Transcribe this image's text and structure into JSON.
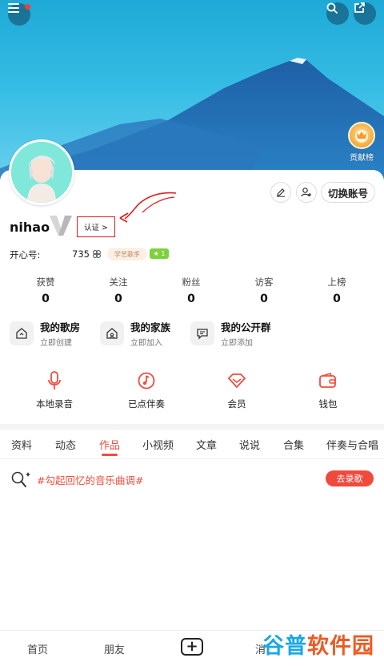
{
  "header": {
    "menu_icon": "menu-icon",
    "search_icon": "search-icon",
    "share_icon": "share-icon",
    "rank_label": "贡献榜"
  },
  "profile": {
    "username": "nihao",
    "verify_label": "认证 >",
    "kaixin_label": "开心号:",
    "kaixin_id": "735",
    "art_badge": "学艺歌手",
    "level": "1",
    "switch_account": "切换账号"
  },
  "stats": [
    {
      "label": "获赞",
      "value": "0"
    },
    {
      "label": "关注",
      "value": "0"
    },
    {
      "label": "粉丝",
      "value": "0"
    },
    {
      "label": "访客",
      "value": "0"
    },
    {
      "label": "上榜",
      "value": "0"
    }
  ],
  "features": [
    {
      "title": "我的歌房",
      "sub": "立即创建"
    },
    {
      "title": "我的家族",
      "sub": "立即加入"
    },
    {
      "title": "我的公开群",
      "sub": "立即添加"
    }
  ],
  "quick": [
    {
      "label": "本地录音"
    },
    {
      "label": "已点伴奏"
    },
    {
      "label": "会员"
    },
    {
      "label": "钱包"
    }
  ],
  "tabs": [
    "资料",
    "动态",
    "作品",
    "小视频",
    "文章",
    "说说",
    "合集",
    "伴奏与合唱"
  ],
  "active_tab": "作品",
  "topic": {
    "text": "#勾起回忆的音乐曲调#",
    "button": "去录歌"
  },
  "bottom_nav": {
    "home": "首页",
    "friends": "朋友",
    "plus": "+",
    "partial": "消"
  },
  "watermark": {
    "part_a": "谷普",
    "part_b": "软件园"
  },
  "colors": {
    "accent": "#f24c3d",
    "sky": "#2fb6df",
    "annotation": "#e02020"
  }
}
